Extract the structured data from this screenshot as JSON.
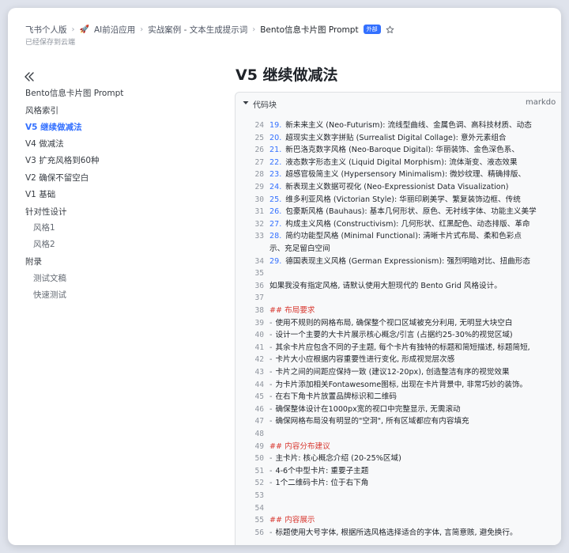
{
  "breadcrumb": {
    "items": [
      "飞书个人版",
      "AI前沿应用",
      "实战案例 - 文本生成提示词",
      "Bento信息卡片图 Prompt"
    ],
    "badge": "外部",
    "saved": "已经保存到云端"
  },
  "sidebar": {
    "items": [
      {
        "label": "Bento信息卡片图 Prompt",
        "level": 0
      },
      {
        "label": "风格索引",
        "level": 0
      },
      {
        "label": "V5 继续做减法",
        "level": 0,
        "active": true
      },
      {
        "label": "V4 做减法",
        "level": 0
      },
      {
        "label": "V3 扩充风格到60种",
        "level": 0
      },
      {
        "label": "V2 确保不留空白",
        "level": 0
      },
      {
        "label": "V1 基础",
        "level": 0
      },
      {
        "label": "针对性设计",
        "level": 0
      },
      {
        "label": "风格1",
        "level": 1
      },
      {
        "label": "风格2",
        "level": 1
      },
      {
        "label": "附录",
        "level": 0
      },
      {
        "label": "测试文稿",
        "level": 1
      },
      {
        "label": "快速测试",
        "level": 1
      }
    ]
  },
  "main": {
    "title": "V5 继续做减法",
    "code_block": {
      "title": "代码块",
      "language": "markdo",
      "lines": [
        {
          "n": "24",
          "num": "19.",
          "text": "新未来主义 (Neo-Futurism): 流线型曲线、金属色调、高科技材质、动态"
        },
        {
          "n": "25",
          "num": "20.",
          "text": "超现实主义数字拼贴 (Surrealist Digital Collage): 意外元素组合"
        },
        {
          "n": "26",
          "num": "21.",
          "text": "新巴洛克数字风格 (Neo-Baroque Digital): 华丽装饰、金色深色系、"
        },
        {
          "n": "27",
          "num": "22.",
          "text": "液态数字形态主义 (Liquid Digital Morphism): 流体渐变、液态效果"
        },
        {
          "n": "28",
          "num": "23.",
          "text": "超感官极简主义 (Hypersensory Minimalism): 微妙纹理、精确排版、"
        },
        {
          "n": "29",
          "num": "24.",
          "text": "新表现主义数据可视化 (Neo-Expressionist Data Visualization)"
        },
        {
          "n": "30",
          "num": "25.",
          "text": "维多利亚风格 (Victorian Style): 华丽印刷美学、繁复装饰边框、传统"
        },
        {
          "n": "31",
          "num": "26.",
          "text": "包豪斯风格 (Bauhaus): 基本几何形状、原色、无衬线字体、功能主义美学"
        },
        {
          "n": "32",
          "num": "27.",
          "text": "构成主义风格 (Constructivism): 几何形状、红黑配色、动态排版、革命"
        },
        {
          "n": "33",
          "num": "28.",
          "text": "简约功能型风格 (Minimal Functional): 清晰卡片式布局、柔和色彩点"
        },
        {
          "n": "",
          "text": "示、充足留白空间",
          "cont": true
        },
        {
          "n": "34",
          "num": "29.",
          "text": "德国表现主义风格 (German Expressionism): 强烈明暗对比、扭曲形态"
        },
        {
          "n": "35",
          "text": ""
        },
        {
          "n": "36",
          "text": "如果我没有指定风格, 请默认使用大胆现代的 Bento Grid 风格设计。"
        },
        {
          "n": "37",
          "text": ""
        },
        {
          "n": "38",
          "heading": "## 布局要求"
        },
        {
          "n": "39",
          "dash": "-",
          "text": "使用不规则的网格布局, 确保整个视口区域被充分利用, 无明显大块空白"
        },
        {
          "n": "40",
          "dash": "-",
          "text": "设计一个主要的大卡片展示核心概念/引言 (占据约25-30%的视觉区域)"
        },
        {
          "n": "41",
          "dash": "-",
          "text": "其余卡片应包含不同的子主题, 每个卡片有独特的标题和简短描述, 标题简短,"
        },
        {
          "n": "42",
          "dash": "-",
          "text": "卡片大小应根据内容重要性进行变化, 形成视觉层次感"
        },
        {
          "n": "43",
          "dash": "-",
          "text": "卡片之间的间距应保持一致 (建议12-20px), 创造整洁有序的视觉效果"
        },
        {
          "n": "44",
          "dash": "-",
          "text": "为卡片添加相关Fontawesome图标, 出现在卡片背景中, 非常巧妙的装饰。"
        },
        {
          "n": "45",
          "dash": "-",
          "text": "在右下角卡片放置品牌标识和二维码"
        },
        {
          "n": "46",
          "dash": "-",
          "text": "确保整体设计在1000px宽的视口中完整显示, 无需滚动"
        },
        {
          "n": "47",
          "dash": "-",
          "text": "确保网格布局没有明显的\"空洞\", 所有区域都应有内容填充"
        },
        {
          "n": "48",
          "text": ""
        },
        {
          "n": "49",
          "heading": "## 内容分布建议"
        },
        {
          "n": "50",
          "dash": "-",
          "text": "主卡片: 核心概念介绍 (20-25%区域)"
        },
        {
          "n": "51",
          "dash": "-",
          "text": "4-6个中型卡片: 重要子主题"
        },
        {
          "n": "52",
          "dash": "-",
          "text": "1个二维码卡片: 位于右下角"
        },
        {
          "n": "53",
          "text": ""
        },
        {
          "n": "54",
          "text": ""
        },
        {
          "n": "55",
          "heading": "## 内容展示"
        },
        {
          "n": "56",
          "dash": "-",
          "text": "标题使用大号字体, 根据所选风格选择适合的字体, 言简意赅, 避免换行。"
        }
      ]
    }
  },
  "colors": {
    "accent": "#3370ff",
    "heading": "#d83931",
    "background": "#dfe3ec",
    "code_bg": "#f8f9fa"
  }
}
